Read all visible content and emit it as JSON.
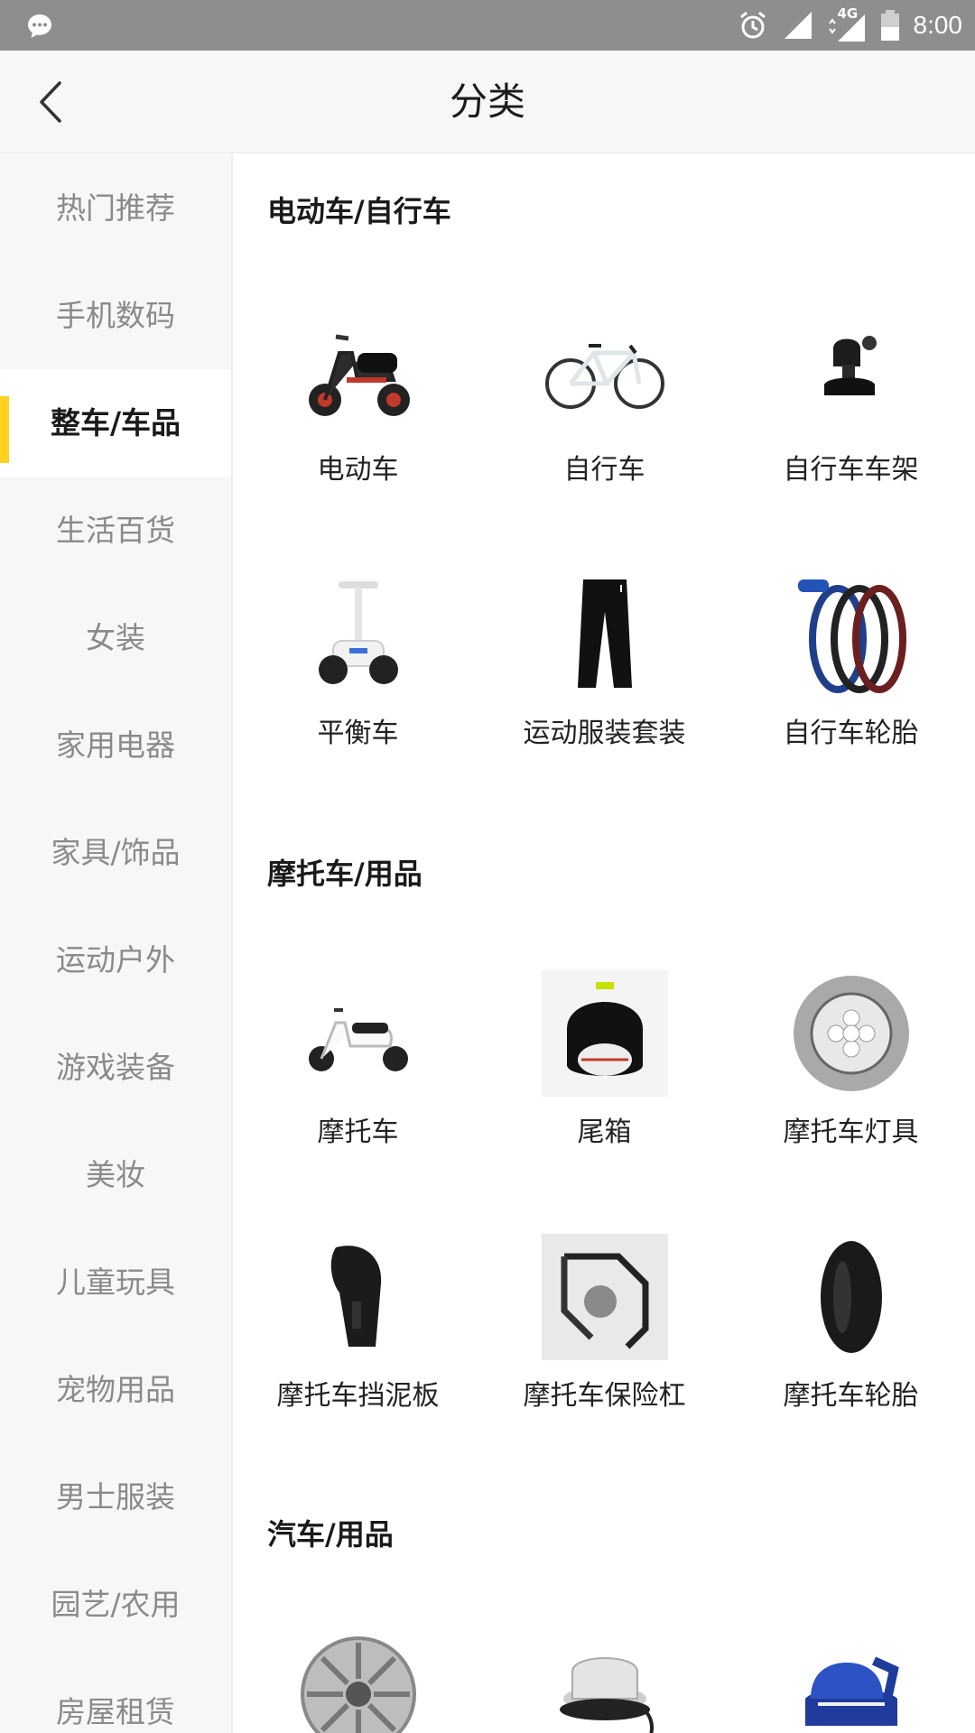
{
  "status_bar": {
    "time": "8:00",
    "network": "4G"
  },
  "header": {
    "title": "分类"
  },
  "sidebar": {
    "items": [
      {
        "label": "热门推荐"
      },
      {
        "label": "手机数码"
      },
      {
        "label": "整车/车品"
      },
      {
        "label": "生活百货"
      },
      {
        "label": "女装"
      },
      {
        "label": "家用电器"
      },
      {
        "label": "家具/饰品"
      },
      {
        "label": "运动户外"
      },
      {
        "label": "游戏装备"
      },
      {
        "label": "美妆"
      },
      {
        "label": "儿童玩具"
      },
      {
        "label": "宠物用品"
      },
      {
        "label": "男士服装"
      },
      {
        "label": "园艺/农用"
      },
      {
        "label": "房屋租赁"
      }
    ],
    "active_index": 2,
    "accent_color": "#ffd21f"
  },
  "sections": [
    {
      "title": "电动车/自行车",
      "items": [
        {
          "label": "电动车",
          "icon": "electric-scooter-icon"
        },
        {
          "label": "自行车",
          "icon": "bicycle-icon"
        },
        {
          "label": "自行车车架",
          "icon": "bike-mount-icon"
        },
        {
          "label": "平衡车",
          "icon": "balance-scooter-icon"
        },
        {
          "label": "运动服装套装",
          "icon": "sport-pants-icon"
        },
        {
          "label": "自行车轮胎",
          "icon": "bike-tire-icon"
        }
      ]
    },
    {
      "title": "摩托车/用品",
      "items": [
        {
          "label": "摩托车",
          "icon": "motor-scooter-icon"
        },
        {
          "label": "尾箱",
          "icon": "top-case-icon"
        },
        {
          "label": "摩托车灯具",
          "icon": "motorcycle-light-icon"
        },
        {
          "label": "摩托车挡泥板",
          "icon": "mudguard-icon"
        },
        {
          "label": "摩托车保险杠",
          "icon": "bumper-bar-icon"
        },
        {
          "label": "摩托车轮胎",
          "icon": "motorcycle-tire-icon"
        }
      ]
    },
    {
      "title": "汽车/用品",
      "items": [
        {
          "label": "",
          "icon": "hubcap-icon"
        },
        {
          "label": "",
          "icon": "warning-light-icon"
        },
        {
          "label": "",
          "icon": "booster-seat-icon"
        }
      ]
    }
  ]
}
